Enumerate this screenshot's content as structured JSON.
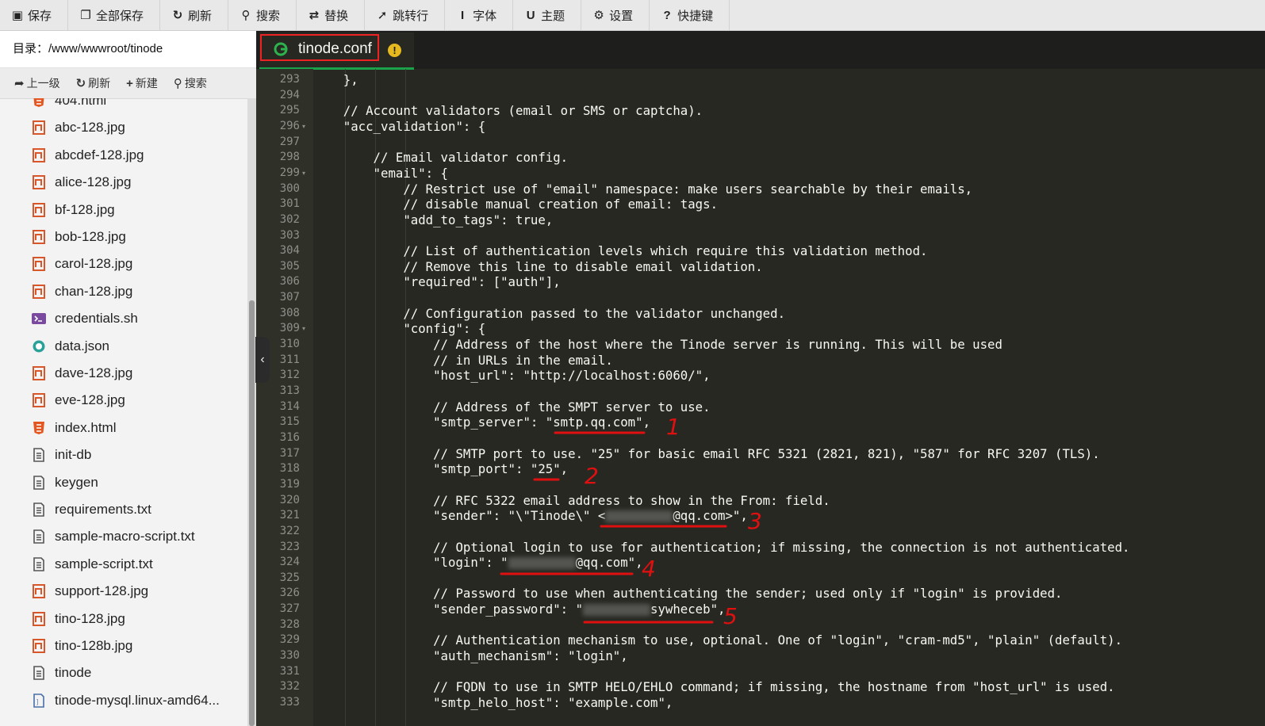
{
  "toolbar": {
    "buttons": [
      {
        "label": "保存",
        "icon": "save-icon"
      },
      {
        "label": "全部保存",
        "icon": "save-all-icon"
      },
      {
        "label": "刷新",
        "icon": "refresh-icon"
      },
      {
        "label": "搜索",
        "icon": "search-icon"
      },
      {
        "label": "替换",
        "icon": "replace-icon"
      },
      {
        "label": "跳转行",
        "icon": "goto-line-icon"
      },
      {
        "label": "字体",
        "icon": "font-icon"
      },
      {
        "label": "主题",
        "icon": "theme-icon"
      },
      {
        "label": "设置",
        "icon": "gear-icon"
      },
      {
        "label": "快捷键",
        "icon": "help-icon"
      }
    ]
  },
  "directory": {
    "label": "目录：",
    "path": "/www/wwwroot/tinode"
  },
  "file_toolbar": {
    "up": "上一级",
    "refresh": "刷新",
    "new": "新建",
    "search": "搜索"
  },
  "files": [
    {
      "name": "404.html",
      "icon": "html-icon"
    },
    {
      "name": "abc-128.jpg",
      "icon": "image-icon"
    },
    {
      "name": "abcdef-128.jpg",
      "icon": "image-icon"
    },
    {
      "name": "alice-128.jpg",
      "icon": "image-icon"
    },
    {
      "name": "bf-128.jpg",
      "icon": "image-icon"
    },
    {
      "name": "bob-128.jpg",
      "icon": "image-icon"
    },
    {
      "name": "carol-128.jpg",
      "icon": "image-icon"
    },
    {
      "name": "chan-128.jpg",
      "icon": "image-icon"
    },
    {
      "name": "credentials.sh",
      "icon": "shell-icon"
    },
    {
      "name": "data.json",
      "icon": "json-icon"
    },
    {
      "name": "dave-128.jpg",
      "icon": "image-icon"
    },
    {
      "name": "eve-128.jpg",
      "icon": "image-icon"
    },
    {
      "name": "index.html",
      "icon": "html-icon"
    },
    {
      "name": "init-db",
      "icon": "text-file-icon"
    },
    {
      "name": "keygen",
      "icon": "text-file-icon"
    },
    {
      "name": "requirements.txt",
      "icon": "text-file-icon"
    },
    {
      "name": "sample-macro-script.txt",
      "icon": "text-file-icon"
    },
    {
      "name": "sample-script.txt",
      "icon": "text-file-icon"
    },
    {
      "name": "support-128.jpg",
      "icon": "image-icon"
    },
    {
      "name": "tino-128.jpg",
      "icon": "image-icon"
    },
    {
      "name": "tino-128b.jpg",
      "icon": "image-icon"
    },
    {
      "name": "tinode",
      "icon": "text-file-icon"
    },
    {
      "name": "tinode-mysql.linux-amd64...",
      "icon": "binary-file-icon"
    }
  ],
  "editor": {
    "tab": {
      "name": "tinode.conf",
      "warning": "!"
    },
    "line_numbers": [
      "293",
      "294",
      "295",
      "296",
      "297",
      "298",
      "299",
      "300",
      "301",
      "302",
      "303",
      "304",
      "305",
      "306",
      "307",
      "308",
      "309",
      "310",
      "311",
      "312",
      "313",
      "314",
      "315",
      "316",
      "317",
      "318",
      "319",
      "320",
      "321",
      "322",
      "323",
      "324",
      "325",
      "326",
      "327",
      "328",
      "329",
      "330",
      "331",
      "332",
      "333"
    ],
    "code_lines": [
      "    },",
      "",
      "    // Account validators (email or SMS or captcha).",
      "    \"acc_validation\": {",
      "",
      "        // Email validator config.",
      "        \"email\": {",
      "            // Restrict use of \"email\" namespace: make users searchable by their emails,",
      "            // disable manual creation of email: tags.",
      "            \"add_to_tags\": true,",
      "",
      "            // List of authentication levels which require this validation method.",
      "            // Remove this line to disable email validation.",
      "            \"required\": [\"auth\"],",
      "",
      "            // Configuration passed to the validator unchanged.",
      "            \"config\": {",
      "                // Address of the host where the Tinode server is running. This will be used",
      "                // in URLs in the email.",
      "                \"host_url\": \"http://localhost:6060/\",",
      "",
      "                // Address of the SMPT server to use.",
      "                \"smtp_server\": \"smtp.qq.com\",",
      "",
      "                // SMTP port to use. \"25\" for basic email RFC 5321 (2821, 821), \"587\" for RFC 3207 (TLS).",
      "                \"smtp_port\": \"25\",",
      "",
      "                // RFC 5322 email address to show in the From: field.",
      "                \"sender\": \"\\\"Tinode\\\" <",
      "",
      "                // Optional login to use for authentication; if missing, the connection is not authenticated.",
      "                \"login\": \"",
      "",
      "                // Password to use when authenticating the sender; used only if \"login\" is provided.",
      "                \"sender_password\": \"",
      "",
      "                // Authentication mechanism to use, optional. One of \"login\", \"cram-md5\", \"plain\" (default).",
      "                \"auth_mechanism\": \"login\",",
      "",
      "                // FQDN to use in SMTP HELO/EHLO command; if missing, the hostname from \"host_url\" is used.",
      "                \"smtp_helo_host\": \"example.com\","
    ],
    "sender_tail": "@qq.com>\",",
    "login_tail": "@qq.com\",",
    "password_tail": "sywheceb\","
  },
  "annotations": [
    "1",
    "2",
    "3",
    "4",
    "5"
  ]
}
